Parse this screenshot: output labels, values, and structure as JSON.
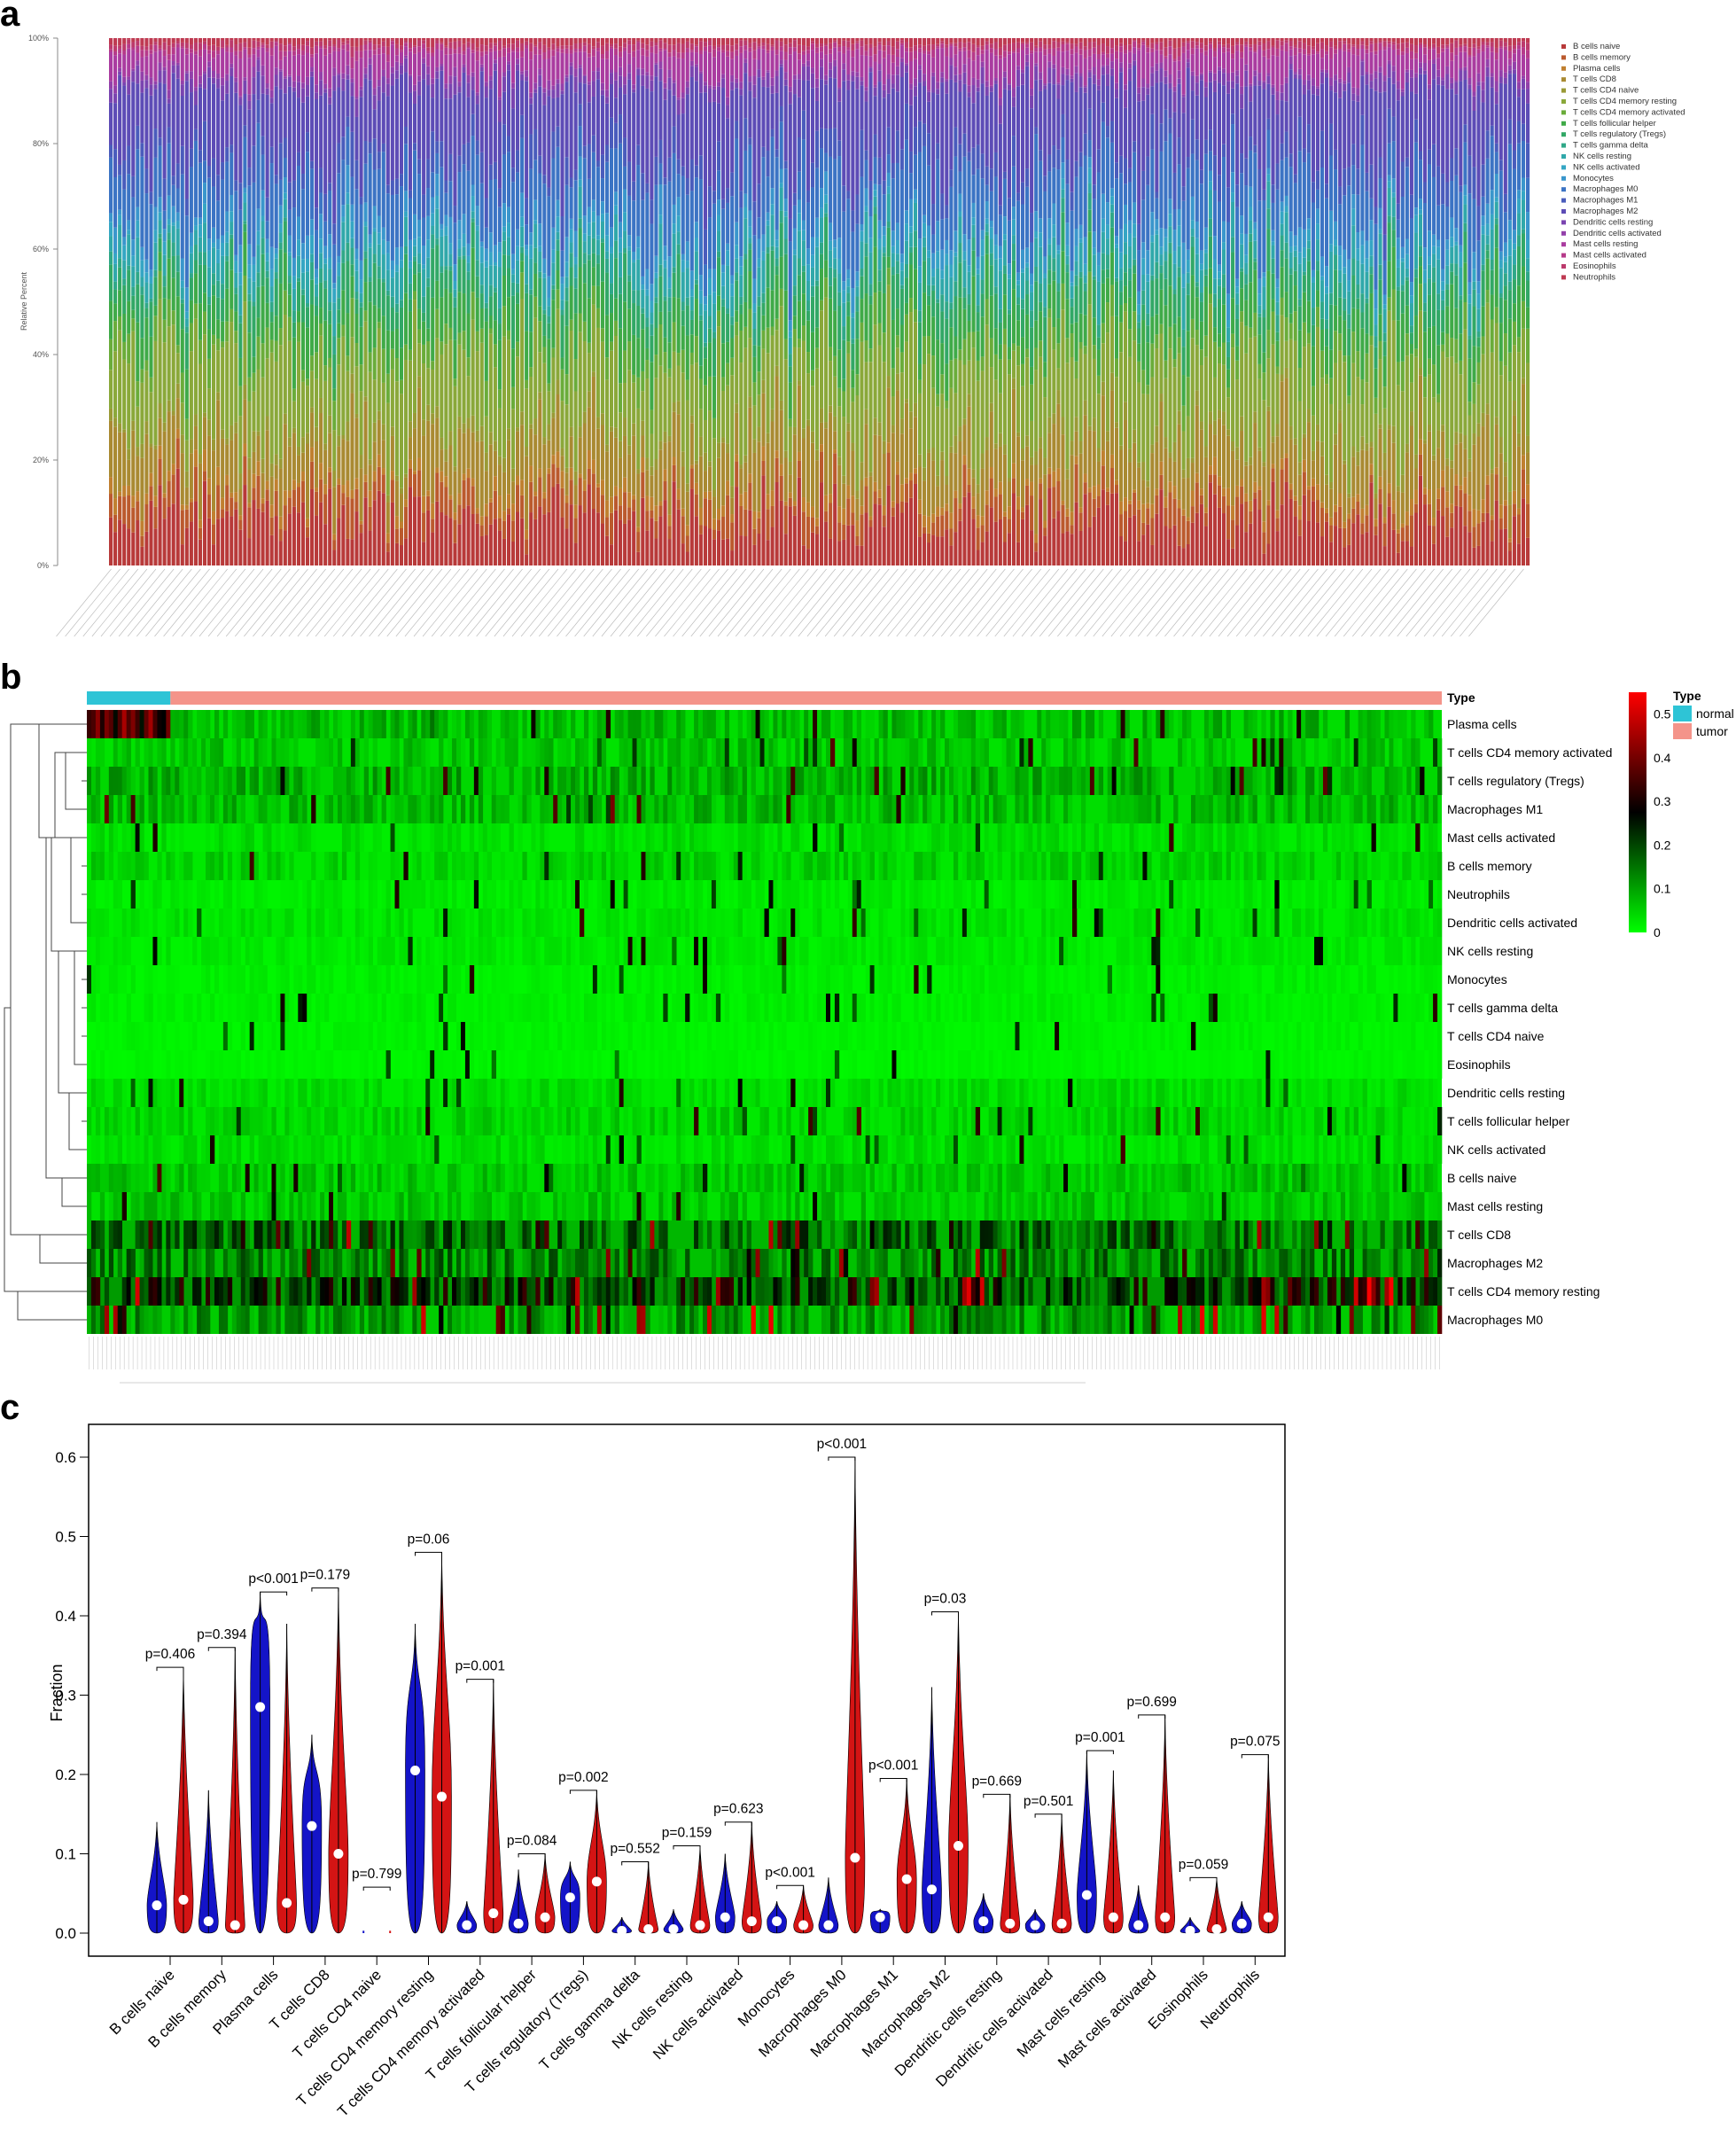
{
  "panels": {
    "a": "a",
    "b": "b",
    "c": "c"
  },
  "chart_data": [
    {
      "type": "bar",
      "subtype": "stacked-percent",
      "ylabel": "Relative Percent",
      "ytick_labels": [
        "0%",
        "20%",
        "40%",
        "60%",
        "80%",
        "100%"
      ],
      "ylim": [
        0,
        100
      ],
      "n_samples": 318,
      "legend_position": "right",
      "series": [
        {
          "name": "B cells naive",
          "color": "#b83a3a"
        },
        {
          "name": "B cells memory",
          "color": "#bb5a2e"
        },
        {
          "name": "Plasma cells",
          "color": "#c08030"
        },
        {
          "name": "T cells CD8",
          "color": "#a98a32"
        },
        {
          "name": "T cells CD4 naive",
          "color": "#9a9a36"
        },
        {
          "name": "T cells CD4 memory resting",
          "color": "#8aa83a"
        },
        {
          "name": "T cells CD4 memory activated",
          "color": "#6aac3a"
        },
        {
          "name": "T cells follicular helper",
          "color": "#3faa48"
        },
        {
          "name": "T cells regulatory (Tregs)",
          "color": "#32a866"
        },
        {
          "name": "T cells gamma delta",
          "color": "#30a888"
        },
        {
          "name": "NK cells resting",
          "color": "#30a8aa"
        },
        {
          "name": "NK cells activated",
          "color": "#35a6c4"
        },
        {
          "name": "Monocytes",
          "color": "#3a96cc"
        },
        {
          "name": "Macrophages M0",
          "color": "#3c74c4"
        },
        {
          "name": "Macrophages M1",
          "color": "#4a5cbc"
        },
        {
          "name": "Macrophages M2",
          "color": "#5d4cb6"
        },
        {
          "name": "Dendritic cells resting",
          "color": "#7a44b0"
        },
        {
          "name": "Dendritic cells activated",
          "color": "#9340aa"
        },
        {
          "name": "Mast cells resting",
          "color": "#aa3ca0"
        },
        {
          "name": "Mast cells activated",
          "color": "#b63a8a"
        },
        {
          "name": "Eosinophils",
          "color": "#bc3a6c"
        },
        {
          "name": "Neutrophils",
          "color": "#bf3a52"
        }
      ]
    },
    {
      "type": "heatmap",
      "title": "",
      "annotation_label": "Type",
      "legend_title": "Type",
      "groups": [
        {
          "name": "normal",
          "color": "#2ec4d6",
          "n": 19
        },
        {
          "name": "tumor",
          "color": "#f4948a",
          "n": 289
        }
      ],
      "rows": [
        "Plasma cells",
        "T cells CD4 memory activated",
        "T cells regulatory (Tregs)",
        "Macrophages M1",
        "Mast cells activated",
        "B cells memory",
        "Neutrophils",
        "Dendritic cells activated",
        "NK cells resting",
        "Monocytes",
        "T cells gamma delta",
        "T cells CD4 naive",
        "Eosinophils",
        "Dendritic cells resting",
        "T cells follicular helper",
        "NK cells activated",
        "B cells naive",
        "Mast cells resting",
        "T cells CD8",
        "Macrophages M2",
        "T cells CD4 memory resting",
        "Macrophages M0"
      ],
      "colorbar": {
        "ticks": [
          "0",
          "0.1",
          "0.2",
          "0.3",
          "0.4",
          "0.5"
        ],
        "range": [
          0,
          0.55
        ],
        "colors": [
          "#00ff00",
          "#000000",
          "#ff0000"
        ]
      }
    },
    {
      "type": "violin",
      "ylabel": "Fraction",
      "ylim": [
        0,
        0.6
      ],
      "yticks": [
        "0.0",
        "0.1",
        "0.2",
        "0.3",
        "0.4",
        "0.5",
        "0.6"
      ],
      "groups": [
        {
          "name": "normal",
          "color": "#1414c8"
        },
        {
          "name": "tumor",
          "color": "#d41414"
        }
      ],
      "categories": [
        "B cells naive",
        "B cells memory",
        "Plasma cells",
        "T cells CD8",
        "T cells CD4 naive",
        "T cells CD4 memory resting",
        "T cells CD4 memory activated",
        "T cells follicular helper",
        "T cells regulatory (Tregs)",
        "T cells gamma delta",
        "NK cells resting",
        "NK cells activated",
        "Monocytes",
        "Macrophages M0",
        "Macrophages M1",
        "Macrophages M2",
        "Dendritic cells resting",
        "Dendritic cells activated",
        "Mast cells resting",
        "Mast cells activated",
        "Eosinophils",
        "Neutrophils"
      ],
      "pvalues": [
        "p=0.406",
        "p=0.394",
        "p<0.001",
        "p=0.179",
        "p=0.799",
        "p=0.06",
        "p=0.001",
        "p=0.084",
        "p=0.002",
        "p=0.552",
        "p=0.159",
        "p=0.623",
        "p<0.001",
        "p<0.001",
        "p<0.001",
        "p=0.03",
        "p=0.669",
        "p=0.501",
        "p=0.001",
        "p=0.699",
        "p=0.059",
        "p=0.075"
      ],
      "normal_max": [
        0.14,
        0.18,
        0.43,
        0.25,
        0.0,
        0.39,
        0.04,
        0.08,
        0.09,
        0.02,
        0.03,
        0.1,
        0.04,
        0.07,
        0.03,
        0.31,
        0.05,
        0.03,
        0.23,
        0.06,
        0.02,
        0.04
      ],
      "normal_median": [
        0.035,
        0.015,
        0.285,
        0.135,
        0.0,
        0.205,
        0.01,
        0.012,
        0.045,
        0.003,
        0.005,
        0.02,
        0.015,
        0.01,
        0.02,
        0.055,
        0.015,
        0.01,
        0.048,
        0.01,
        0.003,
        0.012
      ],
      "tumor_max": [
        0.335,
        0.36,
        0.39,
        0.435,
        0.0,
        0.48,
        0.32,
        0.1,
        0.18,
        0.09,
        0.11,
        0.14,
        0.06,
        0.6,
        0.195,
        0.405,
        0.175,
        0.15,
        0.205,
        0.275,
        0.07,
        0.225
      ],
      "tumor_median": [
        0.042,
        0.01,
        0.038,
        0.1,
        0.0,
        0.172,
        0.025,
        0.02,
        0.065,
        0.005,
        0.01,
        0.015,
        0.01,
        0.095,
        0.068,
        0.11,
        0.012,
        0.012,
        0.02,
        0.02,
        0.005,
        0.02
      ]
    }
  ]
}
